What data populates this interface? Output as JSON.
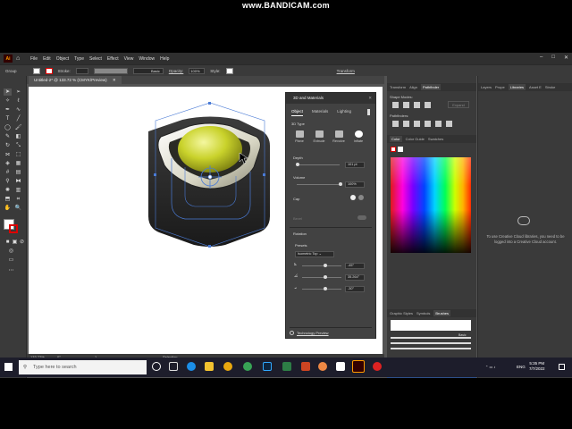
{
  "recorder": {
    "watermark": "www.BANDICAM.com"
  },
  "app": {
    "logo": "Ai",
    "menu": [
      "File",
      "Edit",
      "Object",
      "Type",
      "Select",
      "Effect",
      "View",
      "Window",
      "Help"
    ],
    "window_controls": [
      "–",
      "□",
      "✕"
    ]
  },
  "control_bar": {
    "selection": "Group",
    "stroke_label": "Stroke:",
    "brush_label": "Basic",
    "opacity_label": "Opacity:",
    "opacity_value": "100%",
    "style_label": "Style:",
    "transform_label": "Transform"
  },
  "document": {
    "tab_title": "Untitled-2* @ 133.72 % (CMYK/Preview)",
    "close": "✕"
  },
  "status": {
    "zoom": "133.72%",
    "rotation": "0°",
    "artboard": "1",
    "tool": "Selection"
  },
  "panel_3d": {
    "title": "3D and Materials",
    "tabs": [
      "Object",
      "Materials",
      "Lighting"
    ],
    "active_tab": "Object",
    "section_type": "3D Type",
    "types": [
      "Plane",
      "Extrude",
      "Revolve",
      "Inflate"
    ],
    "depth_label": "Depth",
    "depth_value": "101 pt",
    "volume_label": "Volume",
    "volume_value": "100%",
    "cap_label": "Cap",
    "bevel_label": "Bevel",
    "rotation_label": "Rotation",
    "presets_label": "Presets",
    "preset_value": "Isometric Top",
    "rot_x": "-45°",
    "rot_y": "35.264°",
    "rot_z": "-30°",
    "footer": "Technology Preview"
  },
  "right_panels": {
    "top_tabs": [
      "Transform",
      "Align",
      "Pathfinder"
    ],
    "active_top": "Pathfinder",
    "shape_modes": "Shape Modes:",
    "expand": "Expand",
    "pathfinders": "Pathfinders:",
    "color_tabs": [
      "Color",
      "Color Guide",
      "Swatches"
    ],
    "brush_tabs": [
      "Graphic Styles",
      "Symbols",
      "Brushes"
    ],
    "brush_basic": "Basic",
    "artboard_tabs": [
      "Artboards",
      "Appearance",
      "Transparency"
    ],
    "artboard_row_num": "1",
    "artboard_row_name": "Artboard 1"
  },
  "libraries": {
    "tabs": [
      "Layers",
      "Prope",
      "Libraries",
      "Asset E",
      "Stroke"
    ],
    "message": "To use Creative Cloud libraries, you need to be logged into a Creative Cloud account."
  },
  "taskbar": {
    "search_placeholder": "Type here to search",
    "lang": "ENG",
    "time": "5:35 PM",
    "date": "7/7/2022"
  }
}
